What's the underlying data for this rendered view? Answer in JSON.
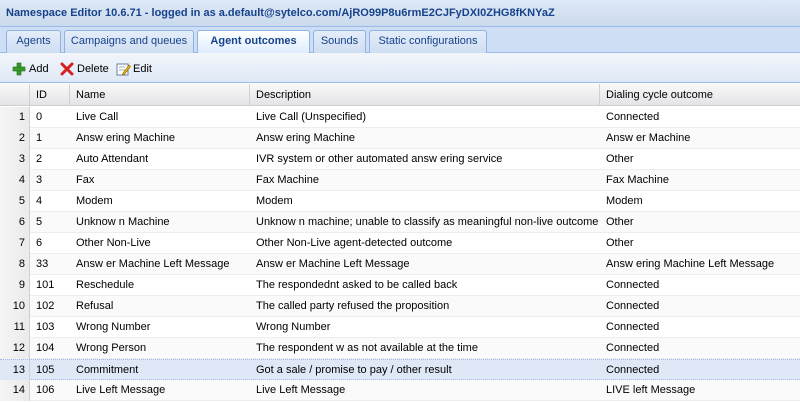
{
  "app": {
    "title": "Namespace Editor 10.6.71 - logged in as a.default@sytelco.com/AjRO99P8u6rmE2CJFyDXI0ZHG8fKNYaZ"
  },
  "tabs": [
    {
      "label": "Agents"
    },
    {
      "label": "Campaigns and queues"
    },
    {
      "label": "Agent outcomes",
      "active": true
    },
    {
      "label": "Sounds"
    },
    {
      "label": "Static configurations"
    }
  ],
  "toolbar": {
    "add_label": "Add",
    "delete_label": "Delete",
    "edit_label": "Edit"
  },
  "grid": {
    "columns": [
      "ID",
      "Name",
      "Description",
      "Dialing cycle outcome"
    ],
    "rows": [
      {
        "n": "1",
        "id": "0",
        "name": "Live Call",
        "description": "Live Call (Unspecified)",
        "outcome": "Connected"
      },
      {
        "n": "2",
        "id": "1",
        "name": "Answ ering Machine",
        "description": "Answ ering Machine",
        "outcome": "Answ er Machine"
      },
      {
        "n": "3",
        "id": "2",
        "name": "Auto Attendant",
        "description": "IVR system or other automated answ ering service",
        "outcome": "Other"
      },
      {
        "n": "4",
        "id": "3",
        "name": "Fax",
        "description": "Fax Machine",
        "outcome": "Fax Machine"
      },
      {
        "n": "5",
        "id": "4",
        "name": "Modem",
        "description": "Modem",
        "outcome": "Modem"
      },
      {
        "n": "6",
        "id": "5",
        "name": "Unknow n Machine",
        "description": "Unknow n machine; unable to classify as meaningful non-live outcome",
        "outcome": "Other"
      },
      {
        "n": "7",
        "id": "6",
        "name": "Other Non-Live",
        "description": "Other Non-Live agent-detected outcome",
        "outcome": "Other"
      },
      {
        "n": "8",
        "id": "33",
        "name": "Answ er Machine Left Message",
        "description": "Answ er Machine Left Message",
        "outcome": "Answ ering Machine Left Message"
      },
      {
        "n": "9",
        "id": "101",
        "name": "Reschedule",
        "description": "The respondednt asked to be called back",
        "outcome": "Connected"
      },
      {
        "n": "10",
        "id": "102",
        "name": "Refusal",
        "description": "The called party refused the proposition",
        "outcome": "Connected"
      },
      {
        "n": "11",
        "id": "103",
        "name": "Wrong Number",
        "description": "Wrong Number",
        "outcome": "Connected"
      },
      {
        "n": "12",
        "id": "104",
        "name": "Wrong Person",
        "description": "The respondent w as not available at the time",
        "outcome": "Connected"
      },
      {
        "n": "13",
        "id": "105",
        "name": "Commitment",
        "description": "Got a sale / promise to pay / other result",
        "outcome": "Connected",
        "selected": true
      },
      {
        "n": "14",
        "id": "106",
        "name": "Live Left Message",
        "description": "Live Left Message",
        "outcome": "LIVE left Message"
      }
    ]
  },
  "colors": {
    "accent": "#15428b",
    "border": "#99bbe8",
    "selected_row": "#dfe8f6"
  },
  "icons": {
    "add": "green-plus-icon",
    "delete": "red-x-icon",
    "edit": "edit-pencil-icon"
  }
}
